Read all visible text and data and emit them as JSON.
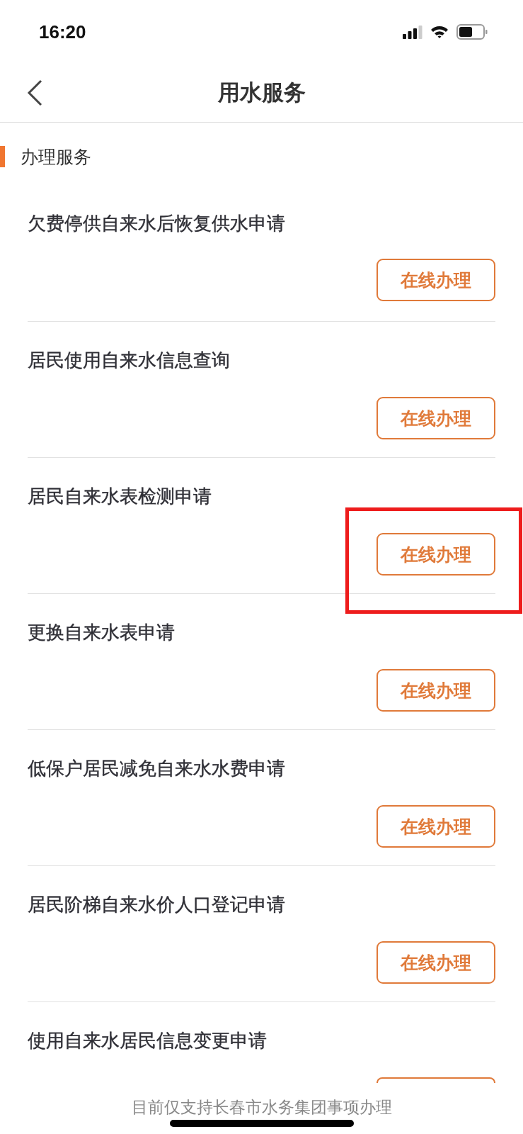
{
  "status_bar": {
    "time": "16:20"
  },
  "nav": {
    "title": "用水服务"
  },
  "section": {
    "title": "办理服务"
  },
  "items": [
    {
      "title": "欠费停供自来水后恢复供水申请",
      "kind": "full",
      "button": "在线办理",
      "highlighted": false
    },
    {
      "title": "居民使用自来水信息查询",
      "kind": "full",
      "button": "在线办理",
      "highlighted": false
    },
    {
      "title": "居民自来水表检测申请",
      "kind": "full",
      "button": "在线办理",
      "highlighted": true
    },
    {
      "title": "更换自来水表申请",
      "kind": "full",
      "button": "在线办理",
      "highlighted": false
    },
    {
      "title": "低保户居民减免自来水水费申请",
      "kind": "full",
      "button": "在线办理",
      "highlighted": false
    },
    {
      "title": "居民阶梯自来水价人口登记申请",
      "kind": "full",
      "button": "在线办理",
      "highlighted": false
    },
    {
      "title": "使用自来水居民信息变更申请",
      "kind": "cut",
      "highlighted": false
    }
  ],
  "footer": {
    "note": "目前仅支持长春市水务集团事项办理"
  }
}
